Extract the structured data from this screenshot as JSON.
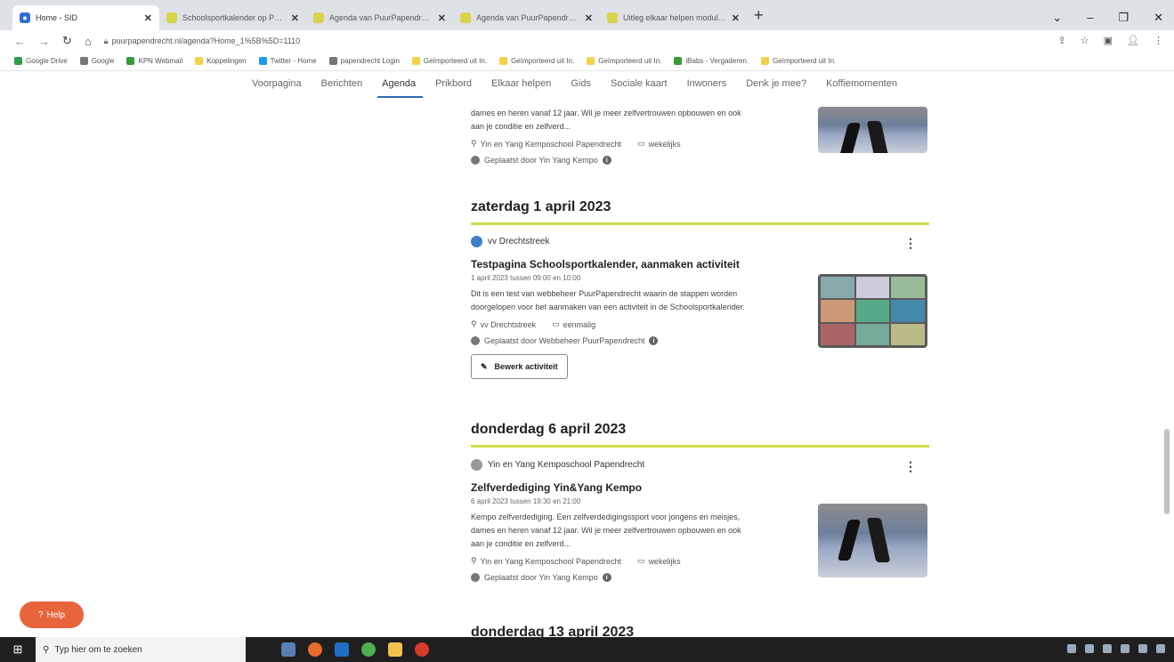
{
  "browser": {
    "tabs": [
      {
        "title": "Home - SID",
        "favicon_color": "#2f6fd6",
        "active": true
      },
      {
        "title": "Schoolsportkalender op PuurPa",
        "favicon_color": "#d8d34a",
        "active": false
      },
      {
        "title": "Agenda van PuurPapendrecht.nl",
        "favicon_color": "#d8d34a",
        "active": false
      },
      {
        "title": "Agenda van PuurPapendrecht.nl",
        "favicon_color": "#d8d34a",
        "active": false
      },
      {
        "title": "Uitleg elkaar helpen module | P",
        "favicon_color": "#d8d34a",
        "active": false
      }
    ],
    "new_tab": "+",
    "url": "puurpapendrecht.nl/agenda?Home_1%5B%5D=1110",
    "bookmarks": [
      {
        "label": "Google Drive",
        "color": "#2e9e4a"
      },
      {
        "label": "Google",
        "color": "#777777"
      },
      {
        "label": "KPN Webmail",
        "color": "#3a9a3a"
      },
      {
        "label": "Koppelingen",
        "color": "#f2d24b"
      },
      {
        "label": "Twitter - Home",
        "color": "#1d9bf0"
      },
      {
        "label": "papendrecht Login",
        "color": "#777777"
      },
      {
        "label": "Geïmporteerd uit In.",
        "color": "#f2d24b"
      },
      {
        "label": "Geïmporteerd uit In.",
        "color": "#f2d24b"
      },
      {
        "label": "Geïmporteerd uit In.",
        "color": "#f2d24b"
      },
      {
        "label": "iBabs - Vergaderen.",
        "color": "#3a9a3a"
      },
      {
        "label": "Geïmporteerd uit In.",
        "color": "#f2d24b"
      }
    ]
  },
  "site_nav": {
    "items": [
      "Voorpagina",
      "Berichten",
      "Agenda",
      "Prikbord",
      "Elkaar helpen",
      "Gids",
      "Sociale kaart",
      "Inwoners",
      "Denk je mee?",
      "Koffiemomenten"
    ],
    "active": "Agenda",
    "accent": "#2b6cb0"
  },
  "top_partial": {
    "desc_lines": [
      "dames en heren vanaf 12 jaar. Wil je meer zelfvertrouwen opbouwen en ook",
      "aan je conditie en zelfverd..."
    ],
    "location": "Yin en Yang Kemposchool Papendrecht",
    "frequency": "wekelijks",
    "posted_by": "Geplaatst door Yin Yang Kempo"
  },
  "days": [
    {
      "heading": "zaterdag 1 april 2023",
      "event": {
        "org": "vv Drechtstreek",
        "title": "Testpagina Schoolsportkalender, aanmaken activiteit",
        "time": "1 april 2023 tussen 09:00 en 10:00",
        "desc_lines": [
          "Dit is een test van webbeheer PuurPapendrecht waarin de stappen worden",
          "doorgelopen voor het aanmaken van een activiteit in de Schoolsportkalender."
        ],
        "location": "vv Drechtstreek",
        "frequency": "eenmalig",
        "posted_by": "Geplaatst door Webbeheer PuurPapendrecht",
        "edit_label": "Bewerk activiteit"
      }
    },
    {
      "heading": "donderdag 6 april 2023",
      "event": {
        "org": "Yin en Yang Kemposchool Papendrecht",
        "title": "Zelfverdediging Yin&Yang Kempo",
        "time": "6 april 2023 tussen 19:30 en 21:00",
        "desc_lines": [
          "Kempo zelfverdediging. Een zelfverdedigingssport voor jongens en meisjes,",
          "dames en heren vanaf 12 jaar. Wil je meer zelfvertrouwen opbouwen en ook",
          "aan je conditie en zelfverd..."
        ],
        "location": "Yin en Yang Kemposchool Papendrecht",
        "frequency": "wekelijks",
        "posted_by": "Geplaatst door Yin Yang Kempo"
      }
    },
    {
      "heading": "donderdag 13 april 2023"
    }
  ],
  "help_button": {
    "label": "Help",
    "color": "#e8643c"
  },
  "date_line_color": "#cddc4a",
  "taskbar": {
    "search_placeholder": "Typ hier om te zoeken"
  }
}
